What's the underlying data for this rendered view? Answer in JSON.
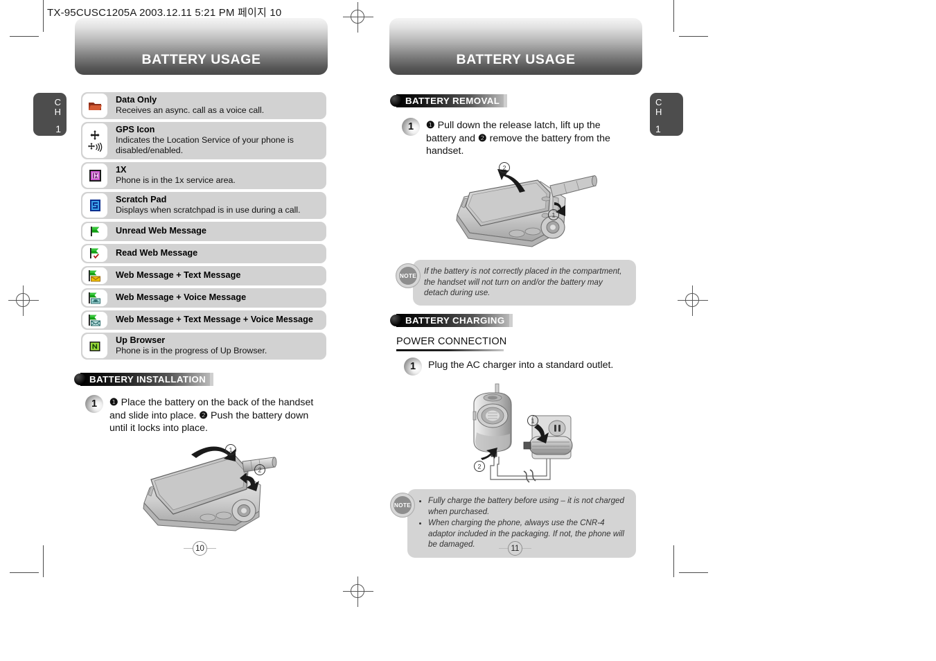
{
  "file_header": "TX-95CUSC1205A  2003.12.11 5:21 PM  페이지 10",
  "left_page": {
    "header_title": "BATTERY USAGE",
    "chapter_tab": {
      "c": "C",
      "h": "H",
      "num": "1"
    },
    "icon_table": [
      {
        "icon": "data-only-icon",
        "title": "Data Only",
        "desc": "Receives an async. call as a voice call."
      },
      {
        "icon": "gps-icon",
        "title": "GPS Icon",
        "desc": "Indicates the Location Service of your phone is disabled/enabled."
      },
      {
        "icon": "onex-icon",
        "title": "1X",
        "desc": "Phone is in the 1x service area."
      },
      {
        "icon": "scratch-pad-icon",
        "title": "Scratch Pad",
        "desc": "Displays when scratchpad is in use during a call."
      },
      {
        "icon": "unread-web-message-icon",
        "title": "Unread Web Message",
        "desc": ""
      },
      {
        "icon": "read-web-message-icon",
        "title": "Read Web Message",
        "desc": ""
      },
      {
        "icon": "web-text-message-icon",
        "title": "Web Message + Text Message",
        "desc": ""
      },
      {
        "icon": "web-voice-message-icon",
        "title": "Web Message + Voice Message",
        "desc": ""
      },
      {
        "icon": "web-text-voice-message-icon",
        "title": "Web Message + Text Message + Voice Message",
        "desc": ""
      },
      {
        "icon": "up-browser-icon",
        "title": "Up Browser",
        "desc": "Phone is in the progress of Up Browser."
      }
    ],
    "section": {
      "label": "BATTERY INSTALLATION"
    },
    "step": {
      "number": "1",
      "text_parts": [
        "❶",
        " Place the battery on the back of the handset and slide into place. ",
        "❷",
        " Push the battery down until it locks into place."
      ]
    },
    "illustration": {
      "name": "handset-battery-install-diagram",
      "callouts": [
        "①",
        "②"
      ]
    },
    "page_number": "10"
  },
  "right_page": {
    "header_title": "BATTERY USAGE",
    "chapter_tab": {
      "c": "C",
      "h": "H",
      "num": "1"
    },
    "section_removal": {
      "label": "BATTERY REMOVAL"
    },
    "step_removal": {
      "number": "1",
      "text_parts": [
        "❶",
        " Pull down the release latch, lift up the battery and ",
        "❷",
        " remove the battery from the handset."
      ]
    },
    "illustration_removal": {
      "name": "handset-battery-removal-diagram",
      "callouts": [
        "①",
        "②"
      ]
    },
    "note_removal": {
      "badge": "NOTE",
      "lines": [
        "If the battery is not correctly placed in the compartment, the handset will not turn on and/or the battery may detach during use."
      ]
    },
    "section_charging": {
      "label": "BATTERY CHARGING"
    },
    "subhead_power": "POWER CONNECTION",
    "step_charging": {
      "number": "1",
      "text": "Plug the AC charger into a standard outlet."
    },
    "illustration_charging": {
      "name": "ac-charger-connection-diagram",
      "callouts": [
        "①",
        "②"
      ]
    },
    "note_charging": {
      "badge": "NOTE",
      "bullets": [
        "Fully charge the battery before using – it is not charged when purchased.",
        "When charging the phone, always use the CNR-4 adaptor included in the packaging. If not, the phone will be damaged."
      ]
    },
    "page_number": "11"
  },
  "colors": {
    "row_bg": "#d2d2d2",
    "header_dark": "#4a4a4a",
    "tab_bg": "#4d4d4d",
    "note_bg": "#d4d4d4"
  }
}
